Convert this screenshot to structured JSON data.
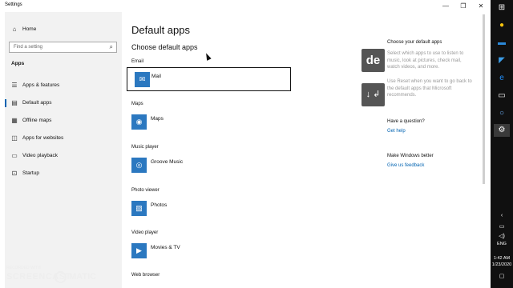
{
  "window": {
    "title": "Settings",
    "controls": [
      "—",
      "❐",
      "✕"
    ]
  },
  "sidebar": {
    "home_label": "Home",
    "search_placeholder": "Find a setting",
    "section": "Apps",
    "items": [
      {
        "label": "Apps & features",
        "icon": "list-icon"
      },
      {
        "label": "Default apps",
        "icon": "default-apps-icon"
      },
      {
        "label": "Offline maps",
        "icon": "map-icon"
      },
      {
        "label": "Apps for websites",
        "icon": "web-icon"
      },
      {
        "label": "Video playback",
        "icon": "video-icon"
      },
      {
        "label": "Startup",
        "icon": "startup-icon"
      }
    ]
  },
  "main": {
    "title": "Default apps",
    "subtitle": "Choose default apps",
    "categories": [
      {
        "label": "Email",
        "app": "Mail",
        "icon": "mail-icon"
      },
      {
        "label": "Maps",
        "app": "Maps",
        "icon": "maps-icon"
      },
      {
        "label": "Music player",
        "app": "Groove Music",
        "icon": "music-icon"
      },
      {
        "label": "Photo viewer",
        "app": "Photos",
        "icon": "photos-icon"
      },
      {
        "label": "Video player",
        "app": "Movies & TV",
        "icon": "movies-icon"
      },
      {
        "label": "Web browser",
        "app": "",
        "icon": ""
      }
    ]
  },
  "right": {
    "heading": "Choose your default apps",
    "text1": "Select which apps to use to listen to music, look at pictures, check mail, watch videos, and more.",
    "text2": "Use Reset when you want to go back to the default apps that Microsoft recommends.",
    "question_heading": "Have a question?",
    "get_help": "Get help",
    "better_heading": "Make Windows better",
    "feedback": "Give us feedback"
  },
  "overlay": {
    "key1": "de",
    "key2": "↓ ↲"
  },
  "taskbar": {
    "icons": [
      "windows-icon",
      "chrome-icon",
      "mail-icon",
      "vscode-icon",
      "ie-icon",
      "terminal-icon",
      "cortana-icon",
      "settings-icon"
    ],
    "lang": "ENG",
    "time": "1:42 AM",
    "date": "1/23/2020"
  },
  "watermark": {
    "small": "RECORDED WITH",
    "big1": "SCREENCAST",
    "big2": "MATIC"
  },
  "colors": {
    "accent": "#0063b1",
    "tile": "#2b78c0",
    "sidebar": "#f2f2f2"
  }
}
